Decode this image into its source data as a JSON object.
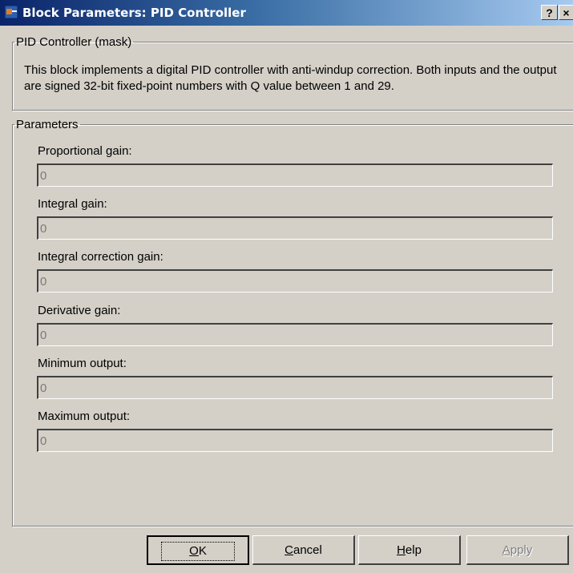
{
  "window": {
    "title": "Block Parameters: PID Controller",
    "help_glyph": "?",
    "close_glyph": "×"
  },
  "mask": {
    "legend": "PID Controller (mask)",
    "description": "This block implements a digital PID controller with anti-windup correction. Both inputs and the output are signed 32-bit fixed-point numbers with Q value between 1 and 29."
  },
  "parameters": {
    "legend": "Parameters",
    "fields": [
      {
        "label": "Proportional gain:",
        "value": "0"
      },
      {
        "label": "Integral gain:",
        "value": "0"
      },
      {
        "label": "Integral correction gain:",
        "value": "0"
      },
      {
        "label": "Derivative gain:",
        "value": "0"
      },
      {
        "label": "Minimum output:",
        "value": "0"
      },
      {
        "label": "Maximum output:",
        "value": "0"
      }
    ]
  },
  "buttons": {
    "ok": {
      "mnemonic": "O",
      "rest": "K"
    },
    "cancel": {
      "mnemonic": "C",
      "rest": "ancel"
    },
    "help": {
      "mnemonic": "H",
      "rest": "elp"
    },
    "apply": {
      "mnemonic": "A",
      "rest": "pply"
    }
  },
  "colors": {
    "title_gradient_start": "#0a246a",
    "title_gradient_end": "#a6caf0",
    "dialog_face": "#d4d0c8"
  },
  "icons": [
    "simulink-block-icon",
    "help-icon",
    "close-icon"
  ]
}
